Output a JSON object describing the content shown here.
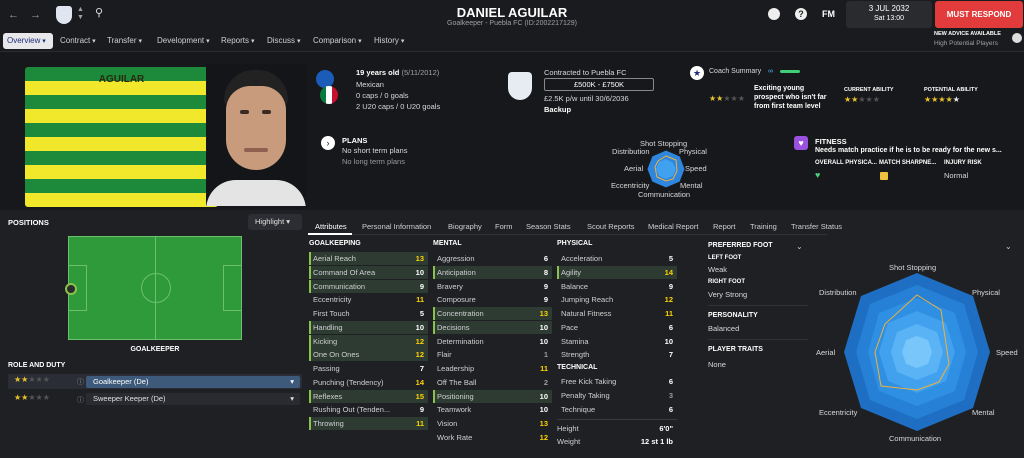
{
  "player": {
    "name": "DANIEL AGUILAR",
    "subtitle": "Goalkeeper - Puebla FC (ID:2002217129)",
    "shirt_name": "AGUILAR",
    "age": "19 years old",
    "dob": "(5/11/2012)",
    "nationality": "Mexican",
    "caps": "0 caps / 0 goals",
    "u20": "2 U20 caps / 0 U20 goals"
  },
  "contract": {
    "title": "Contracted to Puebla FC",
    "value": "£500K - £750K",
    "wage": "£2.5K p/w until 30/6/2036",
    "status": "Backup"
  },
  "coach": {
    "title": "Coach Summary",
    "summary": "Exciting young prospect who isn't far from first team level",
    "current_label": "CURRENT ABILITY",
    "potential_label": "POTENTIAL ABILITY"
  },
  "plans": {
    "title": "PLANS",
    "short": "No short term plans",
    "long": "No long term plans"
  },
  "fitness": {
    "title": "FITNESS",
    "text": "Needs match practice if he is to be ready for the new s...",
    "col1": "OVERALL PHYSICA...",
    "col2": "MATCH SHARPNE...",
    "col3": "INJURY RISK",
    "injury": "Normal"
  },
  "topbar": {
    "date": "3 JUL 2032",
    "day": "Sat 13:00",
    "must_respond": "MUST RESPOND",
    "fm": "FM",
    "advice": "NEW ADVICE AVAILABLE",
    "advice_sub": "High Potential Players"
  },
  "nav": {
    "overview": "Overview",
    "contract": "Contract",
    "transfer": "Transfer",
    "development": "Development",
    "reports": "Reports",
    "discuss": "Discuss",
    "comparison": "Comparison",
    "history": "History"
  },
  "mini_radar": {
    "top": "Shot Stopping",
    "tl": "Distribution",
    "tr": "Physical",
    "l": "Aerial",
    "r": "Speed",
    "bl": "Eccentricity",
    "br": "Mental",
    "b": "Communication"
  },
  "positions": {
    "title": "POSITIONS",
    "highlight": "Highlight",
    "pitch_label": "GOALKEEPER",
    "role_title": "ROLE AND DUTY",
    "role1": "Goalkeeper (De)",
    "role2": "Sweeper Keeper (De)"
  },
  "subtabs": [
    "Attributes",
    "Personal Information",
    "Biography",
    "Form",
    "Season Stats",
    "Scout Reports",
    "Medical Report",
    "Report",
    "Training",
    "Transfer Status"
  ],
  "goalkeeping": {
    "title": "GOALKEEPING",
    "rows": [
      {
        "name": "Aerial Reach",
        "value": "13"
      },
      {
        "name": "Command Of Area",
        "value": "10"
      },
      {
        "name": "Communication",
        "value": "9"
      },
      {
        "name": "Eccentricity",
        "value": "11"
      },
      {
        "name": "First Touch",
        "value": "5"
      },
      {
        "name": "Handling",
        "value": "10"
      },
      {
        "name": "Kicking",
        "value": "12"
      },
      {
        "name": "One On Ones",
        "value": "12"
      },
      {
        "name": "Passing",
        "value": "7"
      },
      {
        "name": "Punching (Tendency)",
        "value": "14"
      },
      {
        "name": "Reflexes",
        "value": "15"
      },
      {
        "name": "Rushing Out (Tenden...",
        "value": "9"
      },
      {
        "name": "Throwing",
        "value": "11"
      }
    ]
  },
  "mental": {
    "title": "MENTAL",
    "rows": [
      {
        "name": "Aggression",
        "value": "6"
      },
      {
        "name": "Anticipation",
        "value": "8"
      },
      {
        "name": "Bravery",
        "value": "9"
      },
      {
        "name": "Composure",
        "value": "9"
      },
      {
        "name": "Concentration",
        "value": "13"
      },
      {
        "name": "Decisions",
        "value": "10"
      },
      {
        "name": "Determination",
        "value": "10"
      },
      {
        "name": "Flair",
        "value": "1"
      },
      {
        "name": "Leadership",
        "value": "11"
      },
      {
        "name": "Off The Ball",
        "value": "2"
      },
      {
        "name": "Positioning",
        "value": "10"
      },
      {
        "name": "Teamwork",
        "value": "10"
      },
      {
        "name": "Vision",
        "value": "13"
      },
      {
        "name": "Work Rate",
        "value": "12"
      }
    ]
  },
  "physical": {
    "title": "PHYSICAL",
    "rows": [
      {
        "name": "Acceleration",
        "value": "5"
      },
      {
        "name": "Agility",
        "value": "14"
      },
      {
        "name": "Balance",
        "value": "9"
      },
      {
        "name": "Jumping Reach",
        "value": "12"
      },
      {
        "name": "Natural Fitness",
        "value": "11"
      },
      {
        "name": "Pace",
        "value": "6"
      },
      {
        "name": "Stamina",
        "value": "10"
      },
      {
        "name": "Strength",
        "value": "7"
      }
    ]
  },
  "technical": {
    "title": "TECHNICAL",
    "rows": [
      {
        "name": "Free Kick Taking",
        "value": "6"
      },
      {
        "name": "Penalty Taking",
        "value": "3"
      },
      {
        "name": "Technique",
        "value": "6"
      }
    ]
  },
  "body": {
    "height_label": "Height",
    "height": "6'0\"",
    "weight_label": "Weight",
    "weight": "12 st 1 lb"
  },
  "info": {
    "foot_title": "PREFERRED FOOT",
    "left_label": "LEFT FOOT",
    "left": "Weak",
    "right_label": "RIGHT FOOT",
    "right": "Very Strong",
    "personality_title": "PERSONALITY",
    "personality": "Balanced",
    "traits_title": "PLAYER TRAITS",
    "traits": "None"
  },
  "big_radar": {
    "top": "Shot Stopping",
    "tl": "Distribution",
    "tr": "Physical",
    "l": "Aerial",
    "r": "Speed",
    "bl": "Eccentricity",
    "br": "Mental",
    "b": "Communication"
  },
  "colors": {
    "accent": "#1f2b7a",
    "red": "#e23b3b",
    "highlight_green": "#8bc34a",
    "radar_blue": "#2e86de"
  }
}
